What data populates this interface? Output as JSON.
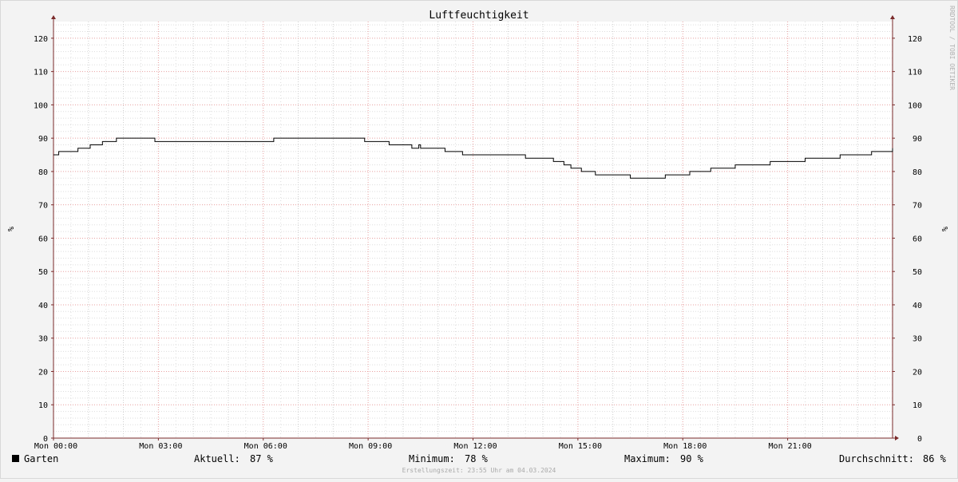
{
  "chart_data": {
    "type": "line",
    "title": "Luftfeuchtigkeit",
    "ylabel": "%",
    "ylabel_right": "%",
    "ylim": [
      0,
      125
    ],
    "xlim": [
      "Mon 00:00",
      "Mon 24:00"
    ],
    "yticks": [
      0,
      10,
      20,
      30,
      40,
      50,
      60,
      70,
      80,
      90,
      100,
      110,
      120
    ],
    "xticks": [
      {
        "label": "Mon 00:00",
        "hour": 0
      },
      {
        "label": "Mon 03:00",
        "hour": 3
      },
      {
        "label": "Mon 06:00",
        "hour": 6
      },
      {
        "label": "Mon 09:00",
        "hour": 9
      },
      {
        "label": "Mon 12:00",
        "hour": 12
      },
      {
        "label": "Mon 15:00",
        "hour": 15
      },
      {
        "label": "Mon 18:00",
        "hour": 18
      },
      {
        "label": "Mon 21:00",
        "hour": 21
      }
    ],
    "grid": true,
    "colors": {
      "background": "#f3f3f3",
      "canvas": "#ffffff",
      "minor_grid": "#dddddd",
      "major_grid": "#e8a0a0",
      "axis": "#7a2a2a",
      "line": "#000000",
      "watermark": "#b0b0b0",
      "footer": "#aaaaaa"
    },
    "series": [
      {
        "name": "Garten",
        "color": "#000000",
        "x": [
          0,
          0.15,
          0.65,
          0.7,
          1.05,
          1.4,
          1.8,
          2.1,
          2.4,
          2.9,
          3.1,
          3.4,
          3.6,
          4.0,
          4.5,
          5.0,
          5.5,
          5.9,
          6.1,
          6.3,
          6.7,
          7.0,
          7.5,
          8.0,
          8.5,
          8.9,
          9.1,
          9.5,
          9.6,
          10.0,
          10.25,
          10.4,
          10.45,
          10.5,
          10.8,
          11.0,
          11.2,
          11.7,
          12.0,
          12.5,
          13.0,
          13.5,
          13.8,
          14.2,
          14.3,
          14.5,
          14.6,
          14.8,
          15.1,
          15.5,
          16.0,
          16.5,
          17.0,
          17.5,
          18.0,
          18.2,
          18.5,
          18.8,
          19.5,
          20.0,
          20.5,
          21.0,
          21.5,
          22.0,
          22.5,
          23.0,
          23.4,
          23.75,
          24.0
        ],
        "y": [
          85,
          86,
          86,
          87,
          88,
          89,
          90,
          90,
          90,
          89,
          89,
          89,
          89,
          89,
          89,
          89,
          89,
          89,
          89,
          90,
          90,
          90,
          90,
          90,
          90,
          89,
          89,
          89,
          88,
          88,
          87,
          87,
          88,
          87,
          87,
          87,
          86,
          85,
          85,
          85,
          85,
          84,
          84,
          84,
          83,
          83,
          82,
          81,
          80,
          79,
          79,
          78,
          78,
          79,
          79,
          80,
          80,
          81,
          82,
          82,
          83,
          83,
          84,
          84,
          85,
          85,
          86,
          86,
          87
        ]
      }
    ]
  },
  "watermark": "RRDTOOL / TOBI OETIKER",
  "legend": {
    "series_name": "Garten",
    "aktuell_label": "Aktuell:",
    "aktuell_value": "87 %",
    "minimum_label": "Minimum:",
    "minimum_value": "78 %",
    "maximum_label": "Maximum:",
    "maximum_value": "90 %",
    "durchschnitt_label": "Durchschnitt:",
    "durchschnitt_value": "86 %"
  },
  "footer": "Erstellungszeit: 23:55 Uhr am 04.03.2024"
}
